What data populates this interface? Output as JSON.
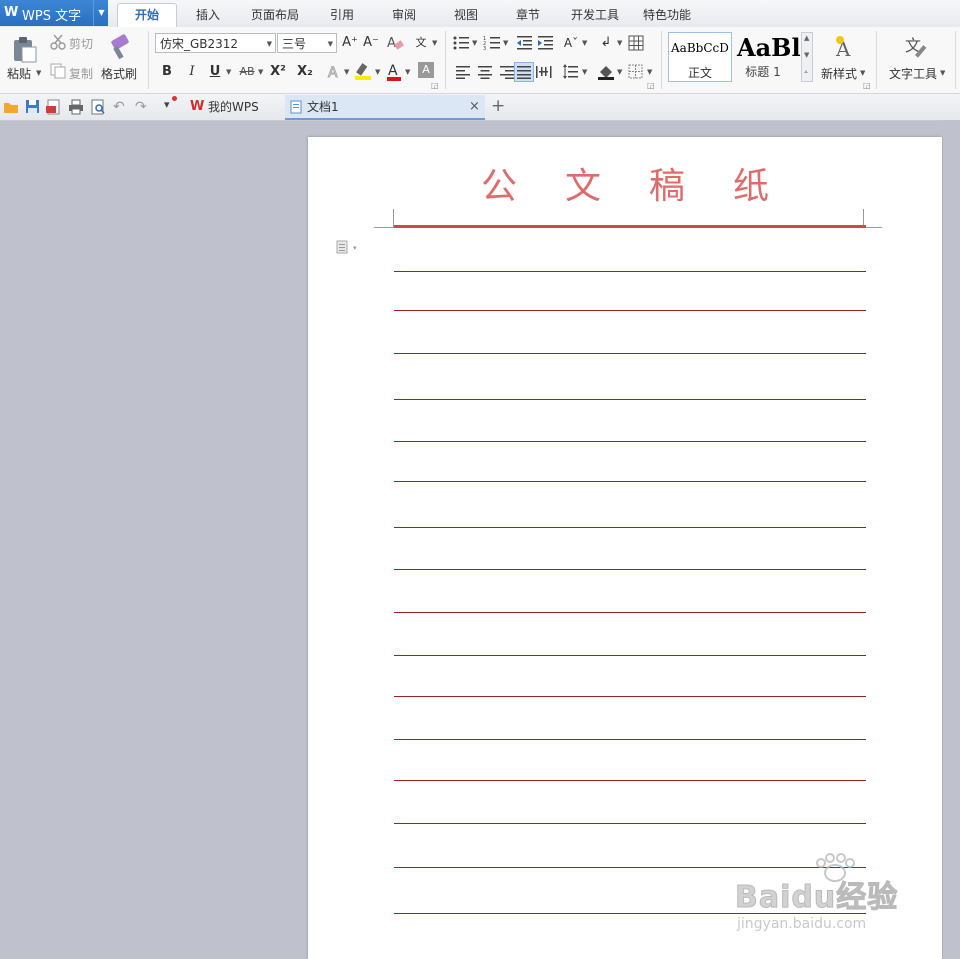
{
  "app": {
    "brand_logo": "W",
    "brand_name": "WPS 文字"
  },
  "menu_tabs": [
    {
      "label": "开始",
      "active": true
    },
    {
      "label": "插入"
    },
    {
      "label": "页面布局"
    },
    {
      "label": "引用"
    },
    {
      "label": "审阅"
    },
    {
      "label": "视图"
    },
    {
      "label": "章节"
    },
    {
      "label": "开发工具"
    },
    {
      "label": "特色功能"
    }
  ],
  "ribbon": {
    "paste_label": "粘贴",
    "cut_label": "剪切",
    "copy_label": "复制",
    "format_painter_label": "格式刷",
    "font_name": "仿宋_GB2312",
    "font_size": "三号",
    "style_normal_preview": "AaBbCcD",
    "style_normal_label": "正文",
    "style_heading_preview": "AaBl",
    "style_heading_label": "标题 1",
    "new_style_label": "新样式",
    "text_tools_label": "文字工具",
    "bold": "B",
    "italic": "I",
    "underline": "U",
    "strike": "AB",
    "superscript": "X²",
    "subscript": "X₂",
    "font_color_glyph": "A",
    "char_shading_glyph": "A",
    "grow_font": "A⁺",
    "shrink_font": "A⁻",
    "phonetic": "文"
  },
  "quickbar": {
    "tab_mywps": "我的WPS",
    "tab_doc": "文档1",
    "close_glyph": "×",
    "add_glyph": "+"
  },
  "document": {
    "title": "公文稿纸"
  },
  "watermark": {
    "text": "Baidu经验",
    "url_text": "jingyan.baidu.com"
  },
  "colors": {
    "accent": "#2d6cb8",
    "title_red": "#e06b6b",
    "rule_red": "#9e1f1f",
    "canvas_bg": "#bfc2cc"
  }
}
